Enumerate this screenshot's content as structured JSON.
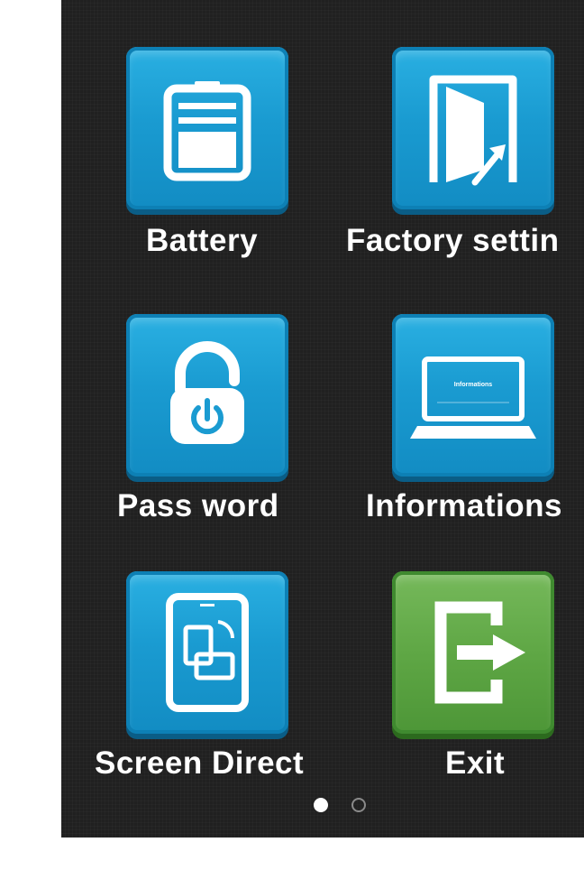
{
  "menu": {
    "items": [
      {
        "label": "Battery",
        "icon": "battery-icon",
        "color": "#1a9bd1"
      },
      {
        "label": "Factory settin",
        "icon": "door-exit-icon",
        "color": "#1a9bd1"
      },
      {
        "label": "Pass word",
        "icon": "lock-power-icon",
        "color": "#1a9bd1"
      },
      {
        "label": "Informations",
        "icon": "laptop-icon",
        "color": "#1a9bd1"
      },
      {
        "label": "Screen Direct",
        "icon": "screen-rotate-icon",
        "color": "#1a9bd1"
      },
      {
        "label": "Exit",
        "icon": "exit-icon",
        "color": "#5fa745"
      }
    ],
    "laptop_screen_text": "Informations"
  },
  "pagination": {
    "pages": 2,
    "current": 1
  }
}
